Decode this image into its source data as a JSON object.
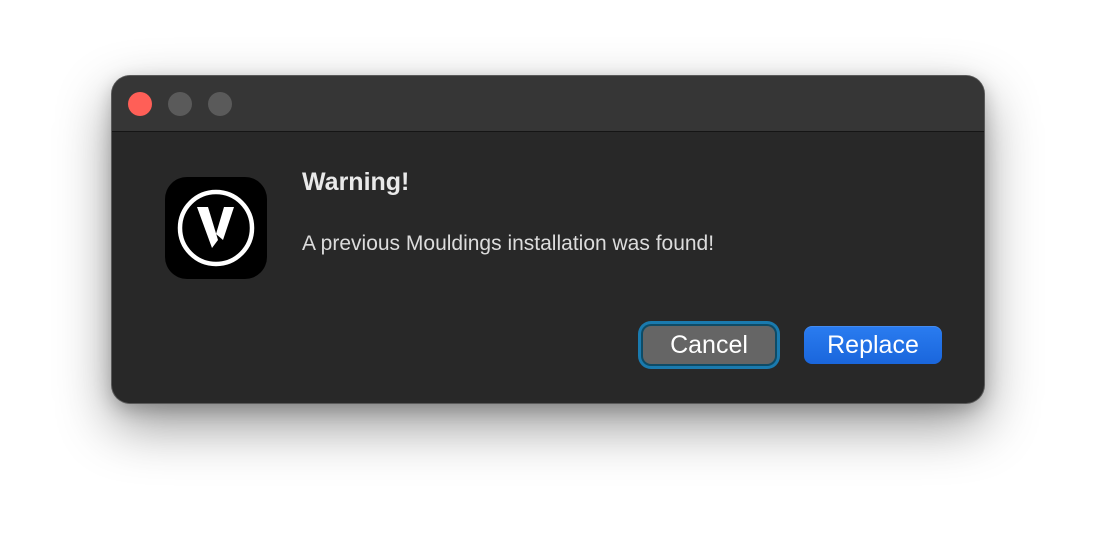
{
  "dialog": {
    "title": "Warning!",
    "message": "A previous Mouldings installation was found!",
    "app_icon": "vectorworks-logo-icon"
  },
  "window_controls": {
    "close_color": "#ff5f57",
    "inactive_color": "#5a5a5a"
  },
  "buttons": {
    "cancel_label": "Cancel",
    "replace_label": "Replace"
  },
  "colors": {
    "window_bg": "#282828",
    "titlebar_bg": "#363636",
    "accent": "#1a66dc",
    "focus_ring": "#1a7aae"
  }
}
